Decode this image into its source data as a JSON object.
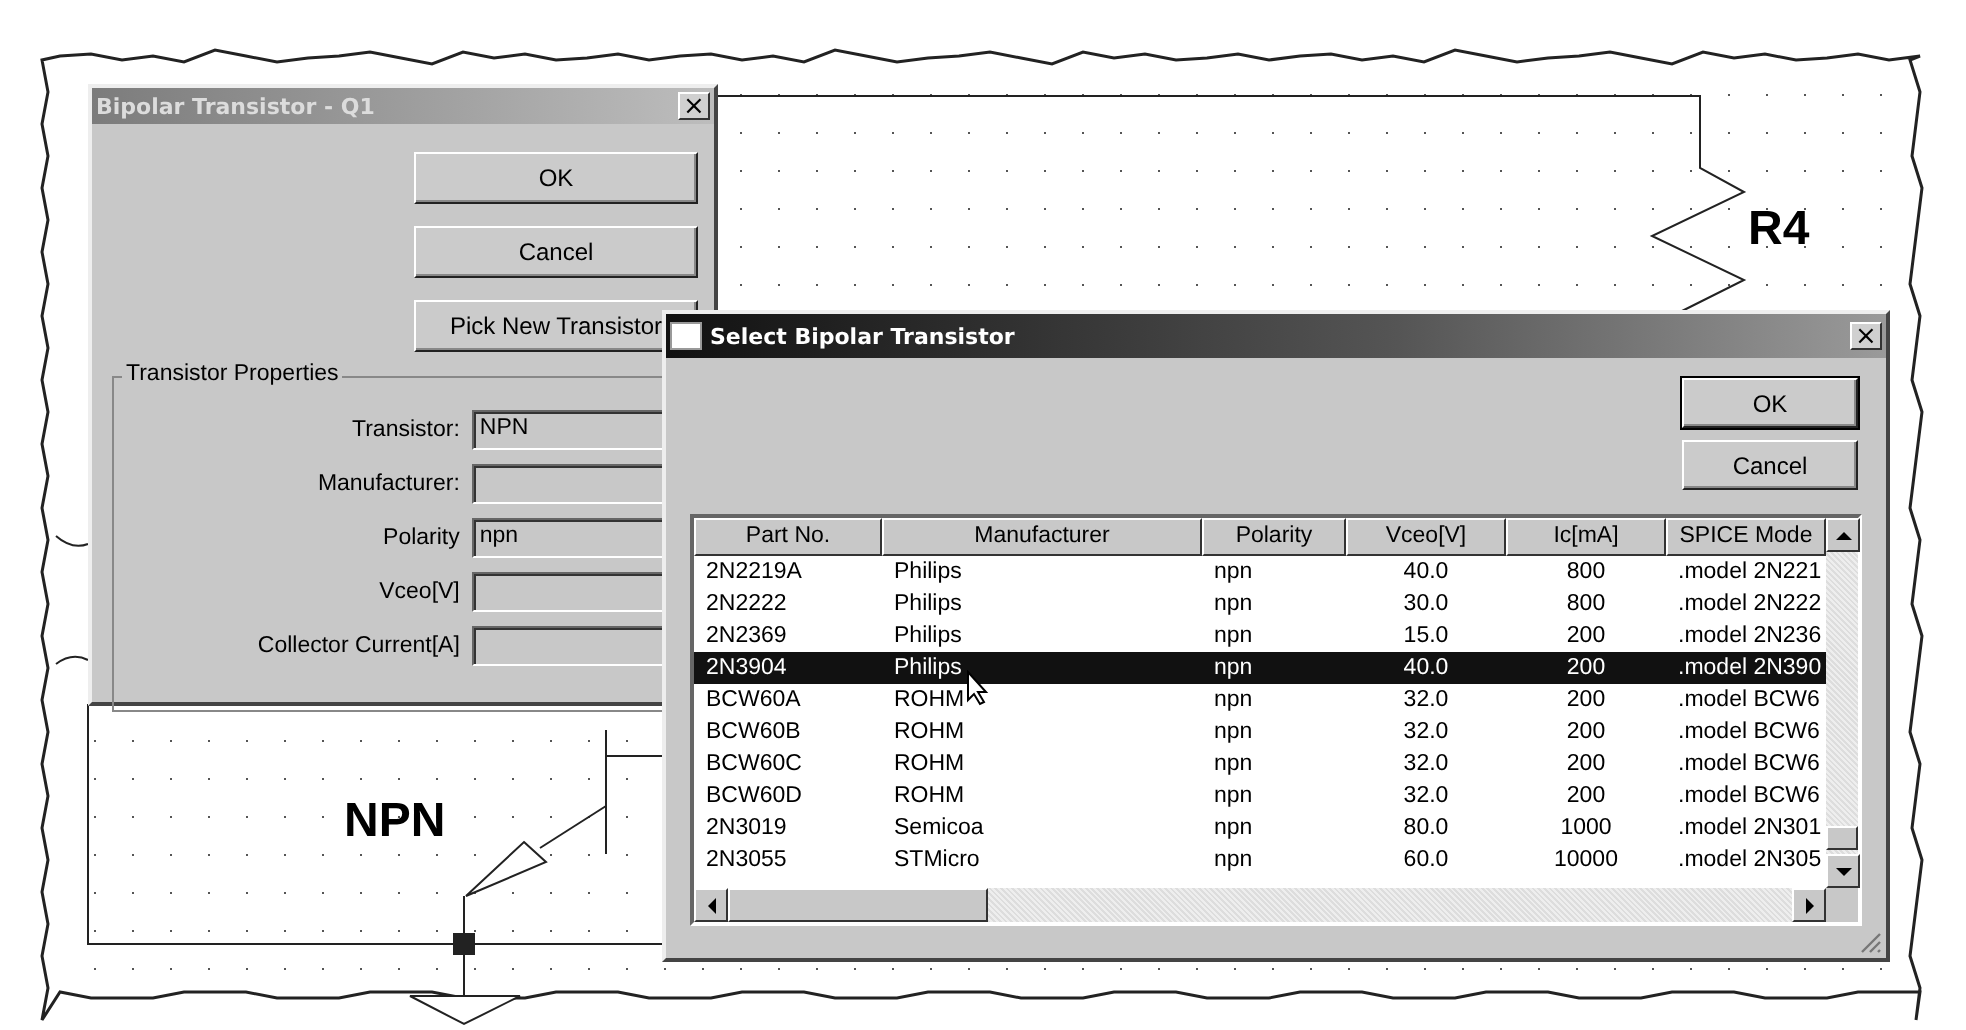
{
  "schematic": {
    "resistor_label": "R4",
    "transistor_label": "NPN"
  },
  "properties_dialog": {
    "title": "Bipolar Transistor - Q1",
    "close": "×",
    "buttons": [
      "OK",
      "Cancel",
      "Pick New Transistor"
    ],
    "group_title": "Transistor Properties",
    "fields": [
      {
        "label": "Transistor:",
        "value": "NPN"
      },
      {
        "label": "Manufacturer:"
      },
      {
        "label": "Polarity",
        "value": "npn"
      },
      {
        "label": "Vceo[V]"
      },
      {
        "label": "Collector Current[A]"
      }
    ]
  },
  "select_dialog": {
    "title": "Select Bipolar Transistor",
    "close": "×",
    "buttons": [
      "OK",
      "Cancel"
    ],
    "table": {
      "columns": [
        "Part No.",
        "Manufacturer",
        "Polarity",
        "Vceo[V]",
        "Ic[mA]",
        "SPICE Mode"
      ],
      "rows": [
        {
          "cells": [
            "2N2219A",
            "Philips",
            "npn",
            "40.0",
            "800",
            ".model 2N221"
          ],
          "selected": false
        },
        {
          "cells": [
            "2N2222",
            "Philips",
            "npn",
            "30.0",
            "800",
            ".model 2N222"
          ],
          "selected": false
        },
        {
          "cells": [
            "2N2369",
            "Philips",
            "npn",
            "15.0",
            "200",
            ".model 2N236"
          ],
          "selected": false
        },
        {
          "cells": [
            "2N3904",
            "Philips",
            "npn",
            "40.0",
            "200",
            ".model 2N390"
          ],
          "selected": true
        },
        {
          "cells": [
            "BCW60A",
            "ROHM",
            "npn",
            "32.0",
            "200",
            ".model BCW6"
          ],
          "selected": false
        },
        {
          "cells": [
            "BCW60B",
            "ROHM",
            "npn",
            "32.0",
            "200",
            ".model BCW6"
          ],
          "selected": false
        },
        {
          "cells": [
            "BCW60C",
            "ROHM",
            "npn",
            "32.0",
            "200",
            ".model BCW6"
          ],
          "selected": false
        },
        {
          "cells": [
            "BCW60D",
            "ROHM",
            "npn",
            "32.0",
            "200",
            ".model BCW6"
          ],
          "selected": false
        },
        {
          "cells": [
            "2N3019",
            "Semicoa",
            "npn",
            "80.0",
            "1000",
            ".model 2N301"
          ],
          "selected": false
        },
        {
          "cells": [
            "2N3055",
            "STMicro",
            "npn",
            "60.0",
            "10000",
            ".model 2N305"
          ],
          "selected": false
        }
      ]
    }
  }
}
